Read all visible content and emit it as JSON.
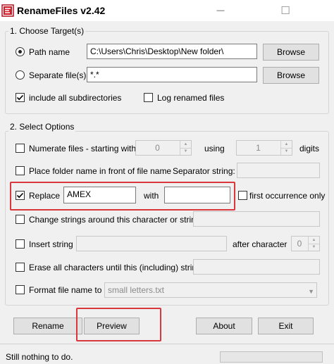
{
  "window": {
    "title": "RenameFiles v2.42",
    "minimize_symbol": "—",
    "maximize_symbol": "☐"
  },
  "target": {
    "legend": "1. Choose Target(s)",
    "path_label": "Path name",
    "path_value": "C:\\Users\\Chris\\Desktop\\New folder\\",
    "path_selected": true,
    "browse_label": "Browse",
    "separate_label": "Separate file(s)",
    "separate_value": "*.*",
    "separate_selected": false,
    "browse2_label": "Browse",
    "subdirs_label": "include all subdirectories",
    "subdirs_checked": true,
    "log_label": "Log renamed files",
    "log_checked": false
  },
  "options": {
    "legend": "2. Select Options",
    "numerate": {
      "label": "Numerate files - starting with",
      "checked": false,
      "start_value": "0",
      "using_label": "using",
      "digits_value": "1",
      "digits_label": "digits"
    },
    "folder_name": {
      "label": "Place folder name in front of file name",
      "checked": false,
      "separator_label": "Separator string:",
      "separator_value": ""
    },
    "replace": {
      "label": "Replace",
      "checked": true,
      "find_value": "AMEX",
      "with_label": "with",
      "with_value": "",
      "first_label": "first occurrence only",
      "first_checked": false
    },
    "change_strings": {
      "label": "Change strings around this character or string",
      "checked": false,
      "value": ""
    },
    "insert_string": {
      "label": "Insert string",
      "checked": false,
      "value": "",
      "after_label": "after character",
      "after_value": "0"
    },
    "erase": {
      "label": "Erase all characters until this (including) string",
      "checked": false,
      "value": ""
    },
    "format": {
      "label": "Format file name to",
      "checked": false,
      "selected": "small letters.txt"
    }
  },
  "buttons": {
    "rename": "Rename",
    "preview": "Preview",
    "about": "About",
    "exit": "Exit"
  },
  "status": {
    "text": "Still nothing to do.",
    "progress": 0
  },
  "colors": {
    "highlight": "#d9363e",
    "progress": "#06b025"
  }
}
